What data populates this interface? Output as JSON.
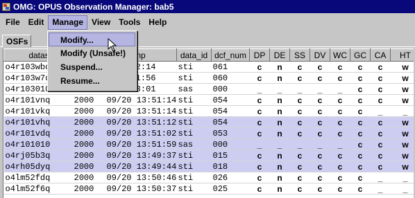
{
  "window": {
    "title": "OMG: OPUS Observation Manager: bab5"
  },
  "menubar": {
    "items": [
      "File",
      "Edit",
      "Manage",
      "View",
      "Tools",
      "Help"
    ],
    "active": "Manage"
  },
  "tabs": [
    "OSFs"
  ],
  "dropdown": {
    "items": [
      "Modify...",
      "Modify (Unsafe!)",
      "Suspend...",
      "Resume..."
    ],
    "highlighted": "Modify..."
  },
  "table": {
    "columns": [
      "datas",
      "",
      "np",
      "data_id",
      "dcf_num",
      "DP",
      "DE",
      "SS",
      "DV",
      "WC",
      "GC",
      "CA",
      "HT"
    ],
    "rows": [
      {
        "dataset": "o4r103wbq",
        "year": "",
        "date": "",
        "time": ":52:14",
        "data_id": "sti",
        "dcf_num": "061",
        "status": [
          "c",
          "n",
          "c",
          "c",
          "c",
          "c",
          "c",
          "w"
        ],
        "selected": false
      },
      {
        "dataset": "o4r103w7q",
        "year": "",
        "date": "",
        "time": ":51:56",
        "data_id": "sti",
        "dcf_num": "060",
        "status": [
          "c",
          "n",
          "c",
          "c",
          "c",
          "c",
          "c",
          "w"
        ],
        "selected": false
      },
      {
        "dataset": "o4r103010",
        "year": "",
        "date": "",
        "time": ":53:01",
        "data_id": "sas",
        "dcf_num": "000",
        "status": [
          "_",
          "_",
          "_",
          "_",
          "_",
          "c",
          "c",
          "w"
        ],
        "selected": false
      },
      {
        "dataset": "o4r101vnq",
        "year": "2000",
        "date": "09/20",
        "time": "13:51:14",
        "data_id": "sti",
        "dcf_num": "054",
        "status": [
          "c",
          "n",
          "c",
          "c",
          "c",
          "c",
          "c",
          "w"
        ],
        "selected": false
      },
      {
        "dataset": "o4r101vkq",
        "year": "2000",
        "date": "09/20",
        "time": "13:51:14",
        "data_id": "sti",
        "dcf_num": "054",
        "status": [
          "c",
          "n",
          "c",
          "c",
          "c",
          "c",
          "_",
          "_"
        ],
        "selected": false
      },
      {
        "dataset": "o4r101vhq",
        "year": "2000",
        "date": "09/20",
        "time": "13:51:12",
        "data_id": "sti",
        "dcf_num": "054",
        "status": [
          "c",
          "n",
          "c",
          "c",
          "c",
          "c",
          "c",
          "w"
        ],
        "selected": true
      },
      {
        "dataset": "o4r101vdq",
        "year": "2000",
        "date": "09/20",
        "time": "13:51:02",
        "data_id": "sti",
        "dcf_num": "053",
        "status": [
          "c",
          "n",
          "c",
          "c",
          "c",
          "c",
          "c",
          "w"
        ],
        "selected": true
      },
      {
        "dataset": "o4r101010",
        "year": "2000",
        "date": "09/20",
        "time": "13:51:59",
        "data_id": "sas",
        "dcf_num": "000",
        "status": [
          "_",
          "_",
          "_",
          "_",
          "_",
          "c",
          "c",
          "w"
        ],
        "selected": true
      },
      {
        "dataset": "o4rj05b3q",
        "year": "2000",
        "date": "09/20",
        "time": "13:49:37",
        "data_id": "sti",
        "dcf_num": "015",
        "status": [
          "c",
          "n",
          "c",
          "c",
          "c",
          "c",
          "c",
          "w"
        ],
        "selected": true
      },
      {
        "dataset": "o4rh05dyq",
        "year": "2000",
        "date": "09/20",
        "time": "13:49:44",
        "data_id": "sti",
        "dcf_num": "018",
        "status": [
          "c",
          "n",
          "c",
          "c",
          "c",
          "c",
          "c",
          "w"
        ],
        "selected": true
      },
      {
        "dataset": "o4lm52fdq",
        "year": "2000",
        "date": "09/20",
        "time": "13:50:46",
        "data_id": "sti",
        "dcf_num": "026",
        "status": [
          "c",
          "n",
          "c",
          "c",
          "c",
          "c",
          "_",
          "_"
        ],
        "selected": false
      },
      {
        "dataset": "o4lm52f6q",
        "year": "2000",
        "date": "09/20",
        "time": "13:50:37",
        "data_id": "sti",
        "dcf_num": "025",
        "status": [
          "c",
          "n",
          "c",
          "c",
          "c",
          "c",
          "_",
          "_"
        ],
        "selected": false
      }
    ]
  }
}
